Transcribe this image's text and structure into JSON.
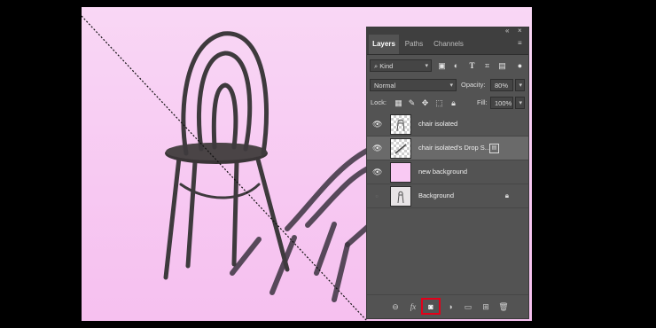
{
  "panel": {
    "collapse_glyph": "«",
    "close_glyph": "×",
    "tabs": [
      {
        "label": "Layers",
        "active": true
      },
      {
        "label": "Paths",
        "active": false
      },
      {
        "label": "Channels",
        "active": false
      }
    ],
    "menu_icon": "panel-menu-icon"
  },
  "filter": {
    "search_glyph": "⌕",
    "kind_label": "Kind",
    "icons": [
      "image-filter-icon",
      "adjustment-filter-icon",
      "type-filter-icon",
      "shape-filter-icon",
      "smart-object-filter-icon",
      "filter-toggle-icon"
    ]
  },
  "blend": {
    "mode": "Normal",
    "opacity_label": "Opacity:",
    "opacity_value": "80%"
  },
  "lock": {
    "label": "Lock:",
    "fill_label": "Fill:",
    "fill_value": "100%",
    "icons": [
      "lock-transparent-icon",
      "lock-image-icon",
      "lock-position-icon",
      "lock-artboard-icon",
      "lock-all-icon"
    ]
  },
  "layers": [
    {
      "name": "chair isolated",
      "visible": true,
      "selected": false,
      "thumb": "checker-chair",
      "locked": false
    },
    {
      "name": "chair isolated's Drop S...",
      "visible": true,
      "selected": true,
      "thumb": "checker-shadow",
      "locked": false,
      "badge": "smart-object-icon"
    },
    {
      "name": "new background",
      "visible": true,
      "selected": false,
      "thumb": "pink",
      "locked": false
    },
    {
      "name": "Background",
      "visible": false,
      "selected": false,
      "thumb": "photo-chair",
      "locked": true
    }
  ],
  "bottom_icons": [
    "link-layers-icon",
    "fx-icon",
    "add-mask-icon",
    "adjustment-layer-icon",
    "new-group-icon",
    "new-layer-icon",
    "trash-icon"
  ],
  "fx_label": "fx",
  "colors": {
    "canvas_bg": "#f8cdf3",
    "panel_bg": "#535353",
    "highlight": "#e2001a"
  }
}
